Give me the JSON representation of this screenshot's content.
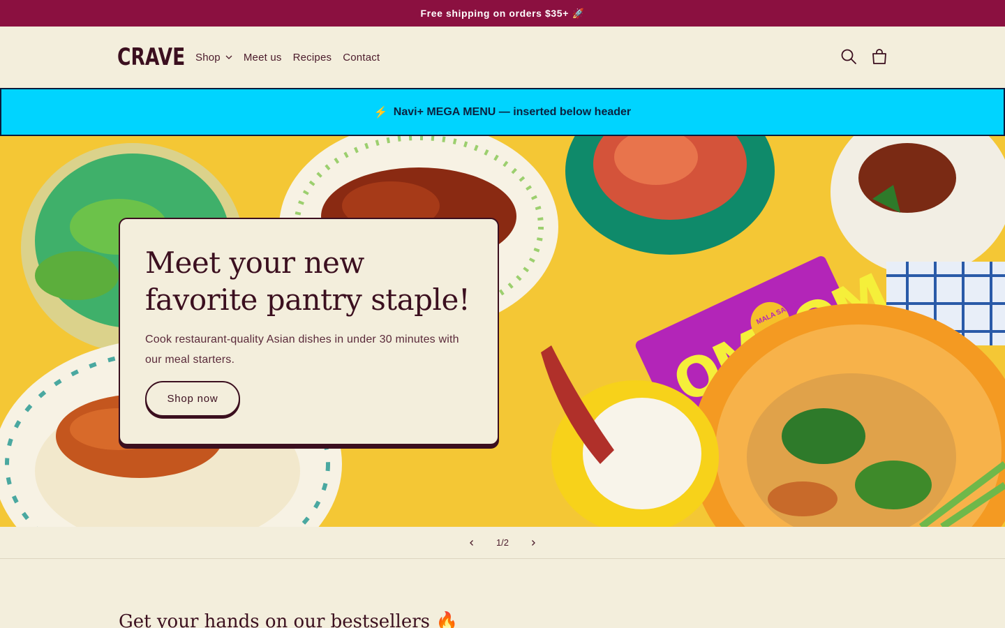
{
  "announcement": {
    "text": "Free shipping on orders $35+ 🚀"
  },
  "header": {
    "logo": "CRAVE",
    "nav": [
      {
        "label": "Shop",
        "has_dropdown": true
      },
      {
        "label": "Meet us"
      },
      {
        "label": "Recipes"
      },
      {
        "label": "Contact"
      }
    ],
    "icons": [
      "search-icon",
      "cart-icon"
    ]
  },
  "mega_menu": {
    "icon": "⚡",
    "text": "Navi+ MEGA MENU — inserted below header"
  },
  "hero": {
    "title": "Meet your new favorite pantry staple!",
    "subtitle": "Cook restaurant-quality Asian dishes in under 30 minutes with our meal starters.",
    "cta": "Shop now",
    "package_label": "MALA SALAD"
  },
  "slider": {
    "counter": "1/2"
  },
  "section": {
    "title": "Get your hands on our bestsellers 🔥"
  },
  "colors": {
    "announce_bg": "#8b1040",
    "mega_bg": "#00d4ff",
    "text": "#3b0f1f",
    "page_bg": "#f3eedc"
  }
}
